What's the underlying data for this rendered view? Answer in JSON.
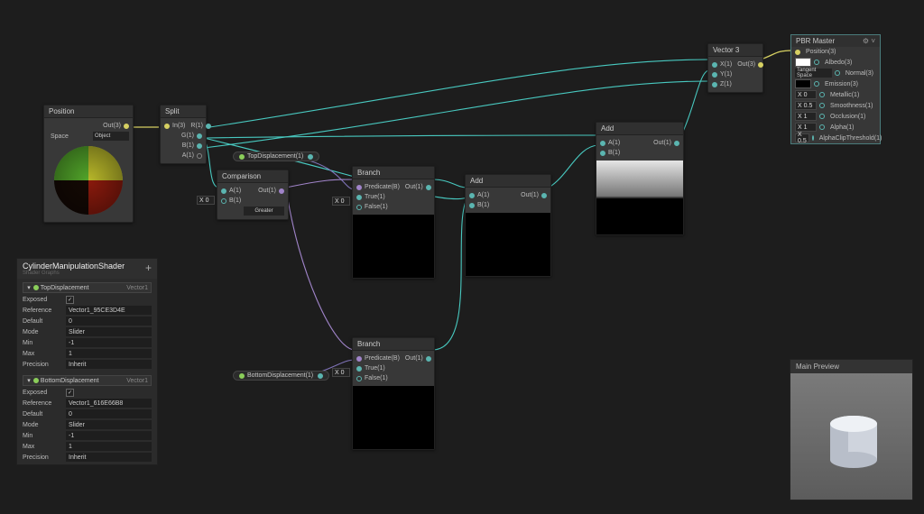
{
  "nodes": {
    "position": {
      "title": "Position",
      "out": "Out(3)",
      "spaceLabel": "Space",
      "spaceValue": "Object"
    },
    "split": {
      "title": "Split",
      "in": "In(3)",
      "r": "R(1)",
      "g": "G(1)",
      "b": "B(1)",
      "a": "A(1)"
    },
    "comparison": {
      "title": "Comparison",
      "a": "A(1)",
      "b": "B(1)",
      "out": "Out(1)",
      "modeLabel": "Greater"
    },
    "branch1": {
      "title": "Branch",
      "predicate": "Predicate(B)",
      "true": "True(1)",
      "false": "False(1)",
      "out": "Out(1)"
    },
    "branch2": {
      "title": "Branch",
      "predicate": "Predicate(B)",
      "true": "True(1)",
      "false": "False(1)",
      "out": "Out(1)"
    },
    "add1": {
      "title": "Add",
      "a": "A(1)",
      "b": "B(1)",
      "out": "Out(1)"
    },
    "add2": {
      "title": "Add",
      "a": "A(1)",
      "b": "B(1)",
      "out": "Out(1)"
    },
    "vector3": {
      "title": "Vector 3",
      "x": "X(1)",
      "y": "Y(1)",
      "z": "Z(1)",
      "out": "Out(3)"
    }
  },
  "inlineValues": {
    "x0": "X  0",
    "x0b": "X  0",
    "x0c": "X  0"
  },
  "pills": {
    "topDisp": "TopDisplacement(1)",
    "bottomDisp": "BottomDisplacement(1)"
  },
  "blackboard": {
    "title": "CylinderManipulationShader",
    "subtitle": "Shader Graphs",
    "props": [
      {
        "name": "TopDisplacement",
        "type": "Vector1",
        "exposed": true,
        "reference": "Vector1_95CE3D4E",
        "default": "0",
        "mode": "Slider",
        "min": "-1",
        "max": "1",
        "precision": "Inherit"
      },
      {
        "name": "BottomDisplacement",
        "type": "Vector1",
        "exposed": true,
        "reference": "Vector1_616E66B8",
        "default": "0",
        "mode": "Slider",
        "min": "-1",
        "max": "1",
        "precision": "Inherit"
      }
    ],
    "labels": {
      "exposed": "Exposed",
      "reference": "Reference",
      "default": "Default",
      "mode": "Mode",
      "min": "Min",
      "max": "Max",
      "precision": "Precision"
    }
  },
  "mainPreview": {
    "title": "Main Preview"
  },
  "pbr": {
    "title": "PBR Master",
    "rows": {
      "position": "Position(3)",
      "albedo": "Albedo(3)",
      "normal": "Normal(3)",
      "normalSpace": "Tangent Space",
      "emission": "Emission(3)",
      "metallic": "Metallic(1)",
      "smoothness": "Smoothness(1)",
      "occlusion": "Occlusion(1)",
      "alpha": "Alpha(1)",
      "alphaClip": "AlphaClipThreshold(1)"
    },
    "values": {
      "x0": "X  0",
      "x05": "X  0.5",
      "x1": "X  1",
      "x1b": "X  1",
      "x05b": "X  0.5"
    }
  }
}
